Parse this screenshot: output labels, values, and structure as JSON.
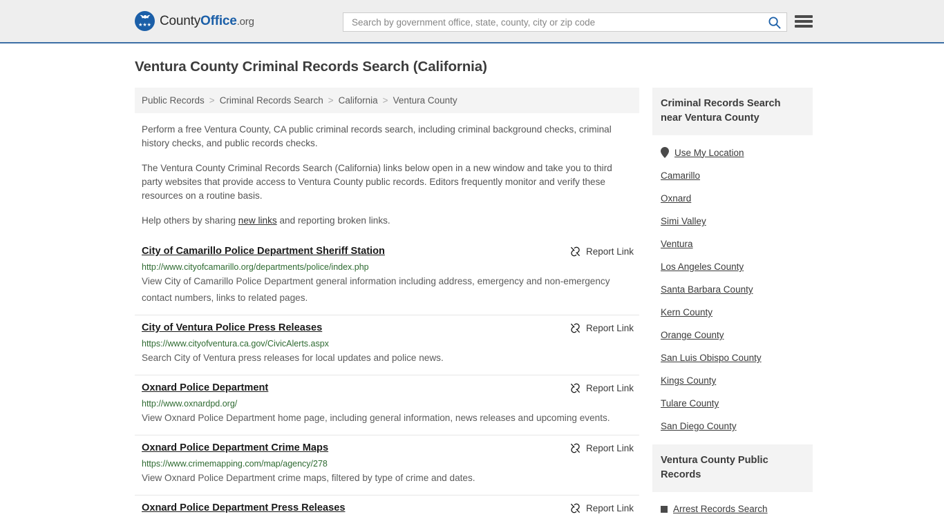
{
  "header": {
    "logo": {
      "part1": "County",
      "part2": "Office",
      "part3": ".org",
      "emblem_icon": "eagle-seal-icon"
    },
    "search": {
      "placeholder": "Search by government office, state, county, city or zip code",
      "value": ""
    },
    "menu_icon": "hamburger-menu-icon",
    "search_icon": "search-icon",
    "accent_color": "#1b5fa8"
  },
  "page": {
    "title": "Ventura County Criminal Records Search (California)",
    "breadcrumb": [
      {
        "label": "Public Records"
      },
      {
        "label": "Criminal Records Search"
      },
      {
        "label": "California"
      },
      {
        "label": "Ventura County"
      }
    ],
    "breadcrumb_separator": ">",
    "intro": {
      "p1": "Perform a free Ventura County, CA public criminal records search, including criminal background checks, criminal history checks, and public records checks.",
      "p2": "The Ventura County Criminal Records Search (California) links below open in a new window and take you to third party websites that provide access to Ventura County public records. Editors frequently monitor and verify these resources on a routine basis.",
      "p3_before": "Help others by sharing ",
      "p3_link": "new links",
      "p3_after": " and reporting broken links."
    }
  },
  "results": {
    "report_label": "Report Link",
    "report_icon": "broken-link-icon",
    "items": [
      {
        "title": "City of Camarillo Police Department Sheriff Station",
        "url": "http://www.cityofcamarillo.org/departments/police/index.php",
        "description": "View City of Camarillo Police Department general information including address, emergency and non-emergency contact numbers, links to related pages."
      },
      {
        "title": "City of Ventura Police Press Releases",
        "url": "https://www.cityofventura.ca.gov/CivicAlerts.aspx",
        "description": "Search City of Ventura press releases for local updates and police news."
      },
      {
        "title": "Oxnard Police Department",
        "url": "http://www.oxnardpd.org/",
        "description": "View Oxnard Police Department home page, including general information, news releases and upcoming events."
      },
      {
        "title": "Oxnard Police Department Crime Maps",
        "url": "https://www.crimemapping.com/map/agency/278",
        "description": "View Oxnard Police Department crime maps, filtered by type of crime and dates."
      },
      {
        "title": "Oxnard Police Department Press Releases",
        "url": "",
        "description": ""
      }
    ]
  },
  "sidebar": {
    "nearby": {
      "heading": "Criminal Records Search near Ventura County",
      "use_my_location": "Use My Location",
      "location_icon": "map-pin-icon",
      "items": [
        {
          "label": "Camarillo"
        },
        {
          "label": "Oxnard"
        },
        {
          "label": "Simi Valley"
        },
        {
          "label": "Ventura"
        },
        {
          "label": "Los Angeles County"
        },
        {
          "label": "Santa Barbara County"
        },
        {
          "label": "Kern County"
        },
        {
          "label": "Orange County"
        },
        {
          "label": "San Luis Obispo County"
        },
        {
          "label": "Kings County"
        },
        {
          "label": "Tulare County"
        },
        {
          "label": "San Diego County"
        }
      ]
    },
    "public_records": {
      "heading": "Ventura County Public Records",
      "items": [
        {
          "label": "Arrest Records Search"
        }
      ]
    }
  }
}
